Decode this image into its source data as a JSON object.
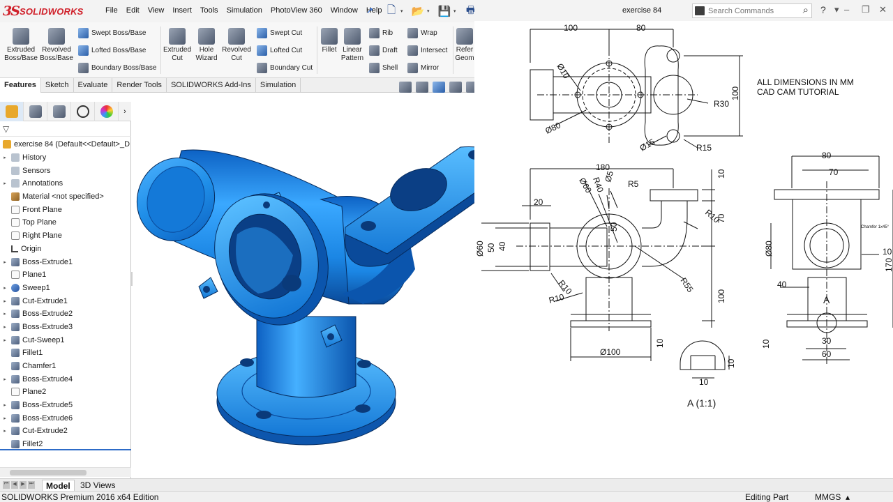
{
  "app": {
    "brand_ds": "3S",
    "brand_name": "SOLIDWORKS",
    "document_title": "exercise 84",
    "menu": [
      "File",
      "Edit",
      "View",
      "Insert",
      "Tools",
      "Simulation",
      "PhotoView 360",
      "Window",
      "Help"
    ],
    "search_placeholder": "Search Commands",
    "help_label": "?"
  },
  "command_manager": {
    "tools": {
      "extruded_boss": "Extruded Boss/Base",
      "revolved_boss": "Revolved Boss/Base",
      "swept_boss": "Swept Boss/Base",
      "lofted_boss": "Lofted Boss/Base",
      "boundary_boss": "Boundary Boss/Base",
      "extruded_cut": "Extruded Cut",
      "hole_wizard": "Hole Wizard",
      "revolved_cut": "Revolved Cut",
      "swept_cut": "Swept Cut",
      "lofted_cut": "Lofted Cut",
      "boundary_cut": "Boundary Cut",
      "fillet": "Fillet",
      "linear_pattern": "Linear Pattern",
      "rib": "Rib",
      "draft": "Draft",
      "shell": "Shell",
      "wrap": "Wrap",
      "intersect": "Intersect",
      "mirror": "Mirror",
      "reference_geometry": "Refer Geom"
    },
    "tabs": [
      "Features",
      "Sketch",
      "Evaluate",
      "Render Tools",
      "SOLIDWORKS Add-Ins",
      "Simulation"
    ],
    "active_tab": "Features"
  },
  "feature_tree": {
    "root": "exercise 84  (Default<<Default>_D",
    "items": [
      {
        "label": "History",
        "icon": "folder",
        "expandable": true
      },
      {
        "label": "Sensors",
        "icon": "folder",
        "expandable": false
      },
      {
        "label": "Annotations",
        "icon": "folder",
        "expandable": true
      },
      {
        "label": "Material <not specified>",
        "icon": "material",
        "expandable": false
      },
      {
        "label": "Front Plane",
        "icon": "plane",
        "expandable": false
      },
      {
        "label": "Top Plane",
        "icon": "plane",
        "expandable": false
      },
      {
        "label": "Right Plane",
        "icon": "plane",
        "expandable": false
      },
      {
        "label": "Origin",
        "icon": "origin",
        "expandable": false
      },
      {
        "label": "Boss-Extrude1",
        "icon": "feat",
        "expandable": true
      },
      {
        "label": "Plane1",
        "icon": "plane",
        "expandable": false
      },
      {
        "label": "Sweep1",
        "icon": "sweep",
        "expandable": true
      },
      {
        "label": "Cut-Extrude1",
        "icon": "feat",
        "expandable": true
      },
      {
        "label": "Boss-Extrude2",
        "icon": "feat",
        "expandable": true
      },
      {
        "label": "Boss-Extrude3",
        "icon": "feat",
        "expandable": true
      },
      {
        "label": "Cut-Sweep1",
        "icon": "feat",
        "expandable": true
      },
      {
        "label": "Fillet1",
        "icon": "feat",
        "expandable": false
      },
      {
        "label": "Chamfer1",
        "icon": "feat",
        "expandable": false
      },
      {
        "label": "Boss-Extrude4",
        "icon": "feat",
        "expandable": true
      },
      {
        "label": "Plane2",
        "icon": "plane",
        "expandable": false
      },
      {
        "label": "Boss-Extrude5",
        "icon": "feat",
        "expandable": true
      },
      {
        "label": "Boss-Extrude6",
        "icon": "feat",
        "expandable": true
      },
      {
        "label": "Cut-Extrude2",
        "icon": "feat",
        "expandable": true
      },
      {
        "label": "Fillet2",
        "icon": "feat",
        "expandable": false
      }
    ]
  },
  "model_tabs": [
    "Model",
    "3D Views"
  ],
  "status": {
    "edition": "SOLIDWORKS Premium 2016 x64 Edition",
    "mode": "Editing Part",
    "units": "MMGS"
  },
  "drawing": {
    "notes": [
      "ALL DIMENSIONS IN MM",
      "CAD CAM TUTORIAL"
    ],
    "top_view_dims": [
      "100",
      "80",
      "Ø10",
      "Ø80",
      "R30",
      "Ø15",
      "R15",
      "100"
    ],
    "front_view_dims": [
      "180",
      "20",
      "Ø60",
      "R40",
      "Ø5",
      "R5",
      "R10",
      "50",
      "70",
      "10",
      "Ø60",
      "50",
      "40",
      "R10",
      "R55",
      "R10",
      "100",
      "Ø100",
      "10"
    ],
    "side_view_dims": [
      "80",
      "70",
      "Ø80",
      "Chamfer 1x45°",
      "10",
      "170",
      "40",
      "A",
      "30",
      "60",
      "10"
    ],
    "detail_dims": [
      "10",
      "10"
    ],
    "detail_label": "A (1:1)"
  },
  "colors": {
    "part_blue": "#1f8ee8",
    "part_dark": "#0a4a9a",
    "brand_red": "#d0202a",
    "selection_blue": "#2d6bc7"
  }
}
